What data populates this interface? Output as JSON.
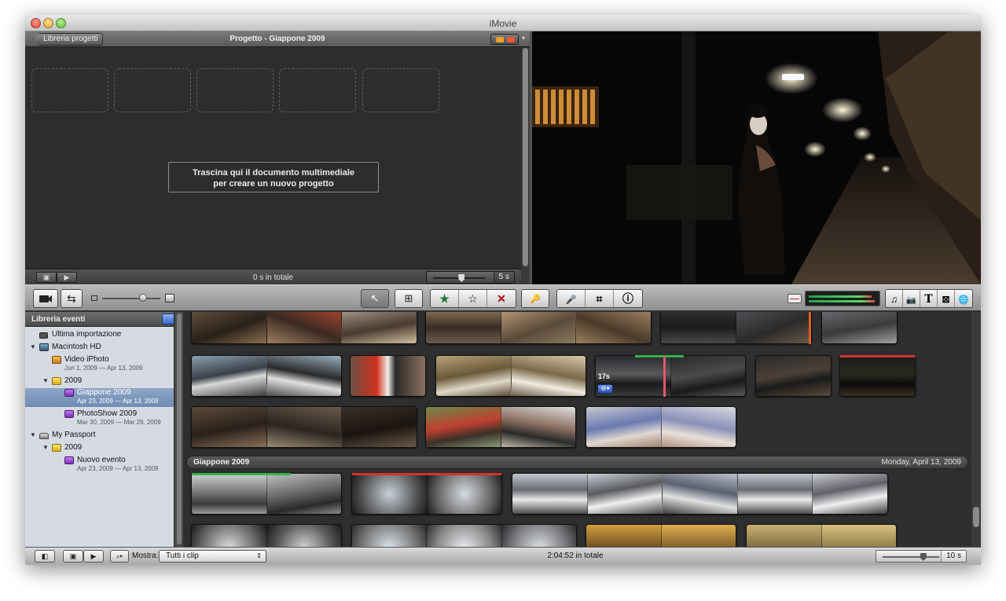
{
  "window": {
    "title": "iMovie"
  },
  "project": {
    "back_label": "Libreria progetti",
    "title": "Progetto - Giappone 2009",
    "menu_glyph": "▾",
    "drop_hint_line1": "Trascina qui il documento multimediale",
    "drop_hint_line2": "per creare un nuovo progetto",
    "total": "0 s in totale",
    "zoom_value": "5 s",
    "zoom_level": 0.55
  },
  "toolbar": {
    "camera": "camera-import-icon",
    "swap": "swap-events-projects-icon",
    "thumb_size_level": 0.7,
    "select_glyph": "↖",
    "add_glyph": "⊞",
    "favorite_glyph": "★",
    "unmark_glyph": "☆",
    "reject_glyph": "✕",
    "keyword_glyph": "🔑",
    "voice_glyph": "🎤",
    "crop_glyph": "⌗",
    "info_glyph": "ⓘ",
    "music_glyph": "♫",
    "photo_glyph": "📷",
    "title_glyph": "T",
    "transition_glyph": "⊠",
    "map_glyph": "🌐"
  },
  "events": {
    "header": "Libreria eventi",
    "items": [
      {
        "name": "Ultima importazione",
        "date": ""
      },
      {
        "name": "Macintosh HD",
        "date": ""
      },
      {
        "name": "Video iPhoto",
        "date": "Jun 1, 2009 — Apr 13, 2009"
      },
      {
        "name": "2009",
        "date": ""
      },
      {
        "name": "Giappone 2009",
        "date": "Apr 23, 2009 — Apr 13, 2009"
      },
      {
        "name": "PhotoShow 2009",
        "date": "Mar 30, 2009 — Mar 29, 2009"
      },
      {
        "name": "My Passport",
        "date": ""
      },
      {
        "name": "2009",
        "date": ""
      },
      {
        "name": "Nuovo evento",
        "date": "Apr 23, 2009 — Apr 13, 2009"
      }
    ]
  },
  "browser": {
    "clip_duration": "17s",
    "section_title": "Giappone 2009",
    "section_date": "Monday, April 13, 2009"
  },
  "footer": {
    "show_label": "Mostra:",
    "show_value": "Tutti i clip",
    "total": "2:04:52 in totale",
    "zoom_value": "10 s",
    "zoom_level": 0.72
  },
  "colors": {
    "favorite": "#2fb34a",
    "rejected": "#d83030",
    "selection": "#7b95bd"
  }
}
